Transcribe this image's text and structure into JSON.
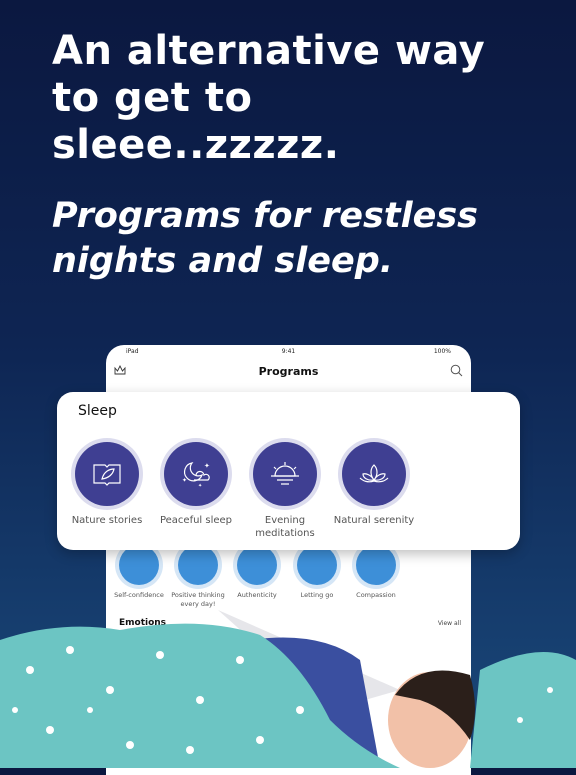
{
  "headline": "An alternative way to get to sleee..zzzzz.",
  "subheadline": "Programs for restless nights and sleep.",
  "tablet": {
    "status": {
      "device": "iPad",
      "time": "9:41",
      "battery": "100%"
    },
    "nav_title": "Programs",
    "icons": {
      "left": "crown-icon",
      "right": "search-icon"
    },
    "programs": [
      {
        "label": "Self-confidence"
      },
      {
        "label": "Positive thinking every day!"
      },
      {
        "label": "Authenticity"
      },
      {
        "label": "Letting go"
      },
      {
        "label": "Compassion"
      }
    ],
    "emotions_title": "Emotions",
    "view_all": "View all"
  },
  "sleep_card": {
    "title": "Sleep",
    "items": [
      {
        "label": "Nature stories",
        "icon": "book-leaf-icon"
      },
      {
        "label": "Peaceful sleep",
        "icon": "moon-stars-icon"
      },
      {
        "label": "Evening meditations",
        "icon": "sunset-icon"
      },
      {
        "label": "Natural serenity",
        "icon": "lotus-icon"
      }
    ]
  },
  "colors": {
    "background": "#0e2553",
    "accent": "#3f3f92",
    "program_blue": "#3d8fd8",
    "blanket": "#6cc5c3"
  }
}
